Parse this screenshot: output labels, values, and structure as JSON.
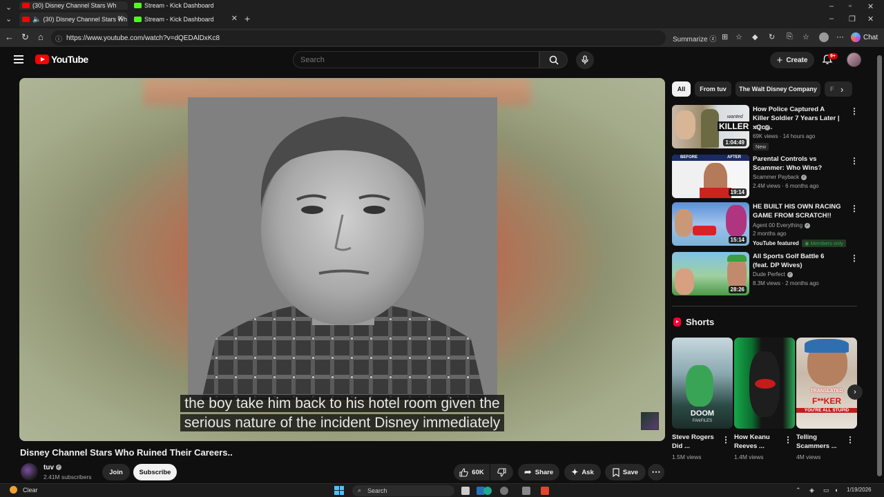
{
  "browser": {
    "tabs": [
      {
        "label": "(30) Disney Channel Stars Wh",
        "active": true
      },
      {
        "label": "Stream - Kick Dashboard",
        "active": false
      }
    ],
    "url": "https://www.youtube.com/watch?v=dQEDAlDxKc8",
    "summarize_label": "Summarize",
    "chat_label": "Chat"
  },
  "header": {
    "logo_text": "YouTube",
    "search_placeholder": "Search",
    "create_label": "Create",
    "notification_count": "9+"
  },
  "player": {
    "caption_line1": "the boy take him back to his hotel room given the",
    "caption_line2": "serious nature of the incident Disney immediately"
  },
  "video": {
    "title": "Disney Channel Stars Who Ruined Their Careers..",
    "channel": "tuv",
    "subscribers": "2.41M subscribers",
    "join_label": "Join",
    "subscribe_label": "Subscribe",
    "likes": "60K",
    "share_label": "Share",
    "ask_label": "Ask",
    "save_label": "Save"
  },
  "chips": [
    "All",
    "From tuv",
    "The Walt Disney Company",
    "F"
  ],
  "recommendations": [
    {
      "title": "How Police Captured A Killer Soldier 7 Years Later | xQc ...",
      "channel": "xQc",
      "meta": "69K views · 14 hours ago",
      "duration": "1:04:49",
      "badge": "New",
      "thumb_text": "KILLER",
      "thumb_sub": "wanted"
    },
    {
      "title": "Parental Controls vs Scammer: Who Wins?",
      "channel": "Scammer Payback",
      "meta": "2.4M views · 6 months ago",
      "duration": "19:14",
      "thumb_before": "BEFORE",
      "thumb_after": "AFTER"
    },
    {
      "title": "HE BUILT HIS OWN RACING GAME FROM SCRATCH!!",
      "channel": "Agent 00 Everything",
      "meta": "2 months ago",
      "duration": "15:14",
      "featured": "YouTube featured",
      "members": "Members only"
    },
    {
      "title": "All Sports Golf Battle 6 (feat. DP Wives)",
      "channel": "Dude Perfect",
      "meta": "8.3M views · 2 months ago",
      "duration": "28:26"
    }
  ],
  "shorts": {
    "heading": "Shorts",
    "items": [
      {
        "title": "Steve Rogers Did ...",
        "views": "1.5M views",
        "thumb_text": "DOOM",
        "thumb_sub": "FANFILES"
      },
      {
        "title": "How Keanu Reeves ...",
        "views": "1.4M views"
      },
      {
        "title": "Telling Scammers ...",
        "views": "4M views",
        "thumb_text": "F**KER",
        "thumb_sub": "YOU'RE ALL STUPID",
        "thumb_top": "TRANSLATED"
      }
    ]
  },
  "taskbar": {
    "weather": "Clear",
    "search_label": "Search",
    "date": "1/19/2026"
  },
  "colors": {
    "youtube_red": "#ff0000",
    "background": "#0f0f0f",
    "members_green": "#2ba640"
  }
}
